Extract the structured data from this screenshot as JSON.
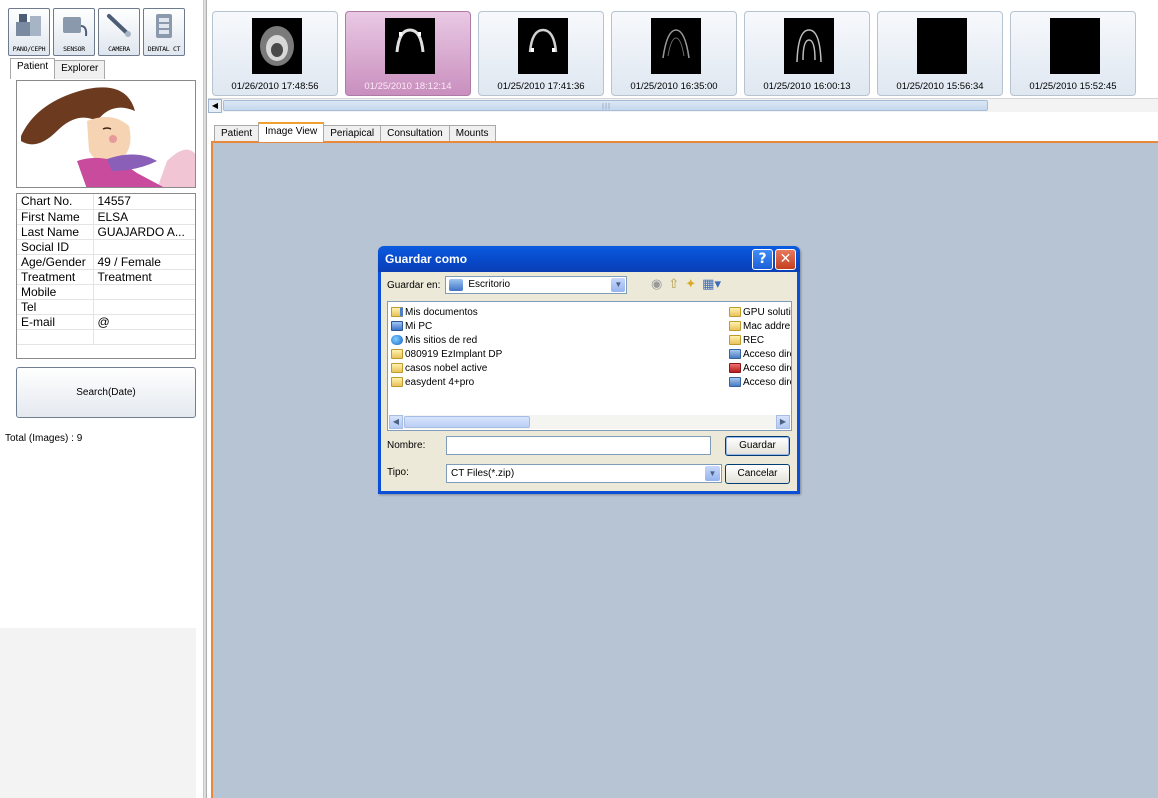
{
  "modules": [
    {
      "label": "PANO/CEPH",
      "icon": "pano-ceph-icon"
    },
    {
      "label": "SENSOR",
      "icon": "sensor-icon"
    },
    {
      "label": "CAMERA",
      "icon": "camera-icon"
    },
    {
      "label": "DENTAL CT",
      "icon": "dental-ct-icon"
    }
  ],
  "left_tabs": [
    "Patient",
    "Explorer"
  ],
  "patient_info": [
    {
      "key": "Chart No.",
      "value": "14557"
    },
    {
      "key": "First Name",
      "value": "ELSA"
    },
    {
      "key": "Last Name",
      "value": "GUAJARDO A..."
    },
    {
      "key": "Social ID",
      "value": ""
    },
    {
      "key": "Age/Gender",
      "value": "49 / Female"
    },
    {
      "key": "Treatment",
      "value": "Treatment"
    },
    {
      "key": "Mobile",
      "value": ""
    },
    {
      "key": "Tel",
      "value": ""
    },
    {
      "key": "E-mail",
      "value": "@"
    },
    {
      "key": "",
      "value": ""
    }
  ],
  "search_button": "Search(Date)",
  "total_images": "Total (Images) : 9",
  "thumbnails": [
    {
      "date": "01/26/2010 17:48:56",
      "selected": false
    },
    {
      "date": "01/25/2010 18:12:14",
      "selected": true
    },
    {
      "date": "01/25/2010 17:41:36",
      "selected": false
    },
    {
      "date": "01/25/2010 16:35:00",
      "selected": false
    },
    {
      "date": "01/25/2010 16:00:13",
      "selected": false
    },
    {
      "date": "01/25/2010 15:56:34",
      "selected": false
    },
    {
      "date": "01/25/2010 15:52:45",
      "selected": false
    }
  ],
  "main_tabs": [
    "Patient",
    "Image View",
    "Periapical",
    "Consultation",
    "Mounts"
  ],
  "active_main_tab": "Image View",
  "dialog": {
    "title": "Guardar como",
    "help_glyph": "?",
    "close_glyph": "✕",
    "save_in_label": "Guardar en:",
    "save_in_value": "Escritorio",
    "files_left": [
      {
        "name": "Mis documentos",
        "icon": "docs"
      },
      {
        "name": "Mi PC",
        "icon": "pc"
      },
      {
        "name": "Mis sitios de red",
        "icon": "net"
      },
      {
        "name": "080919 EzImplant DP",
        "icon": "folder"
      },
      {
        "name": "casos nobel active",
        "icon": "folder"
      },
      {
        "name": "easydent 4+pro",
        "icon": "folder"
      }
    ],
    "files_right": [
      {
        "name": "GPU solutic",
        "icon": "folder"
      },
      {
        "name": "Mac addre:",
        "icon": "folder"
      },
      {
        "name": "REC",
        "icon": "folder"
      },
      {
        "name": "Acceso dire",
        "icon": "link"
      },
      {
        "name": "Acceso dire",
        "icon": "zip"
      },
      {
        "name": "Acceso dire",
        "icon": "link"
      }
    ],
    "name_label": "Nombre:",
    "name_value": "",
    "type_label": "Tipo:",
    "type_value": "CT Files(*.zip)",
    "save_button": "Guardar",
    "cancel_button": "Cancelar"
  },
  "colors": {
    "view_background": "#b6c4d4",
    "dialog_title": "#0848c8",
    "tab_accent": "#f0a030",
    "selected_thumb": "#c98fbe"
  }
}
